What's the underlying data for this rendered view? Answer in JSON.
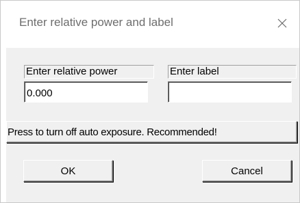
{
  "window": {
    "title": "Enter relative power and label",
    "close_glyph": "×"
  },
  "fields": {
    "power_label": "Enter relative power",
    "power_value": "0.000",
    "label_label": "Enter label",
    "label_value": ""
  },
  "buttons": {
    "auto_exposure": "Press to turn off auto exposure. Recommended!",
    "ok": "OK",
    "cancel": "Cancel"
  },
  "icons": {
    "close": "close-icon"
  }
}
